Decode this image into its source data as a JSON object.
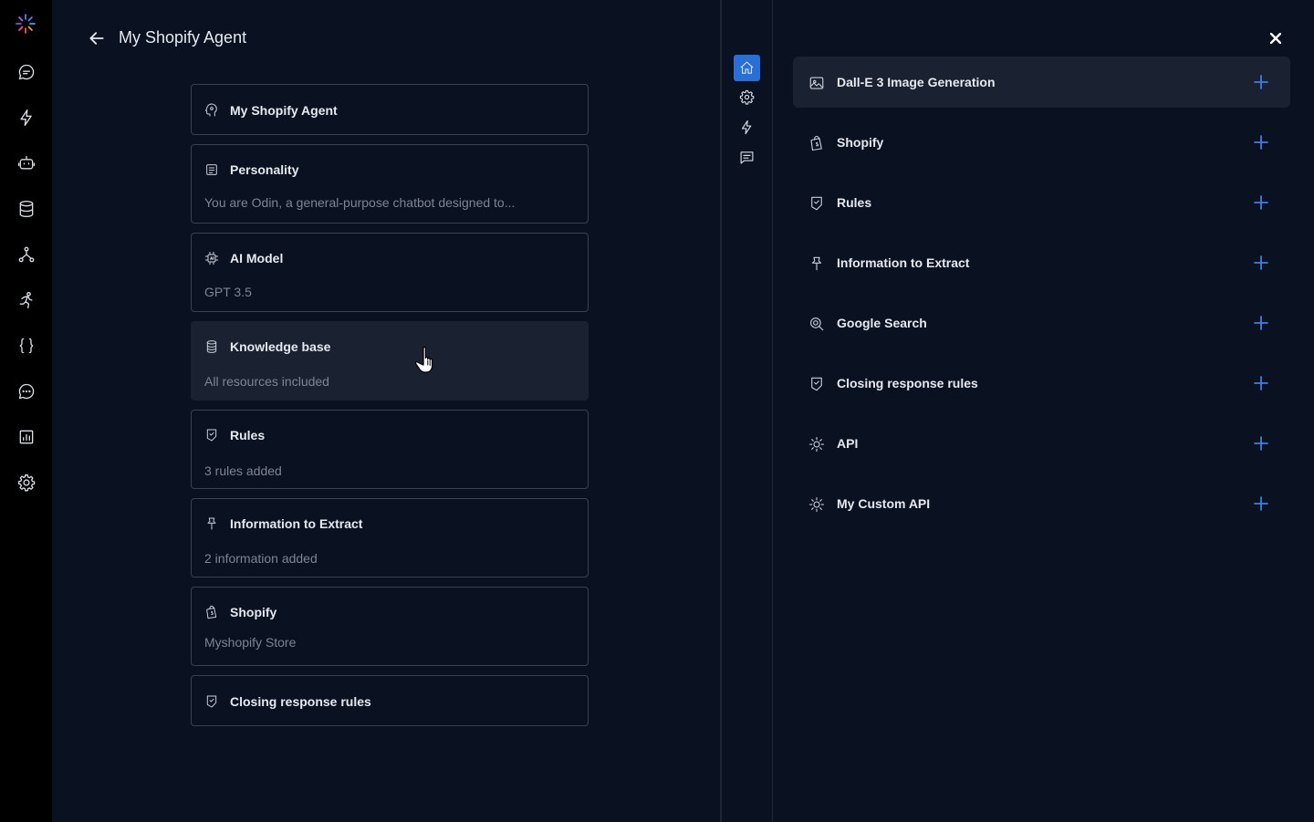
{
  "header": {
    "title": "My Shopify Agent"
  },
  "cards": [
    {
      "name": "My Shopify Agent",
      "sub": ""
    },
    {
      "name": "Personality",
      "sub": "You are Odin, a general-purpose chatbot designed to..."
    },
    {
      "name": "AI Model",
      "sub": "GPT 3.5"
    },
    {
      "name": "Knowledge base",
      "sub": "All resources included"
    },
    {
      "name": "Rules",
      "sub": "3 rules added"
    },
    {
      "name": "Information to Extract",
      "sub": "2 information added"
    },
    {
      "name": "Shopify",
      "sub": "Myshopify Store"
    },
    {
      "name": "Closing response rules",
      "sub": ""
    }
  ],
  "tools": [
    {
      "name": "Dall-E 3 Image Generation"
    },
    {
      "name": "Shopify"
    },
    {
      "name": "Rules"
    },
    {
      "name": "Information to Extract"
    },
    {
      "name": "Google Search"
    },
    {
      "name": "Closing response rules"
    },
    {
      "name": "API"
    },
    {
      "name": "My Custom API"
    }
  ],
  "colors": {
    "accent": "#2a6fd6",
    "plus": "#3d7fe6",
    "background": "#0a1120",
    "rail": "#000000"
  }
}
